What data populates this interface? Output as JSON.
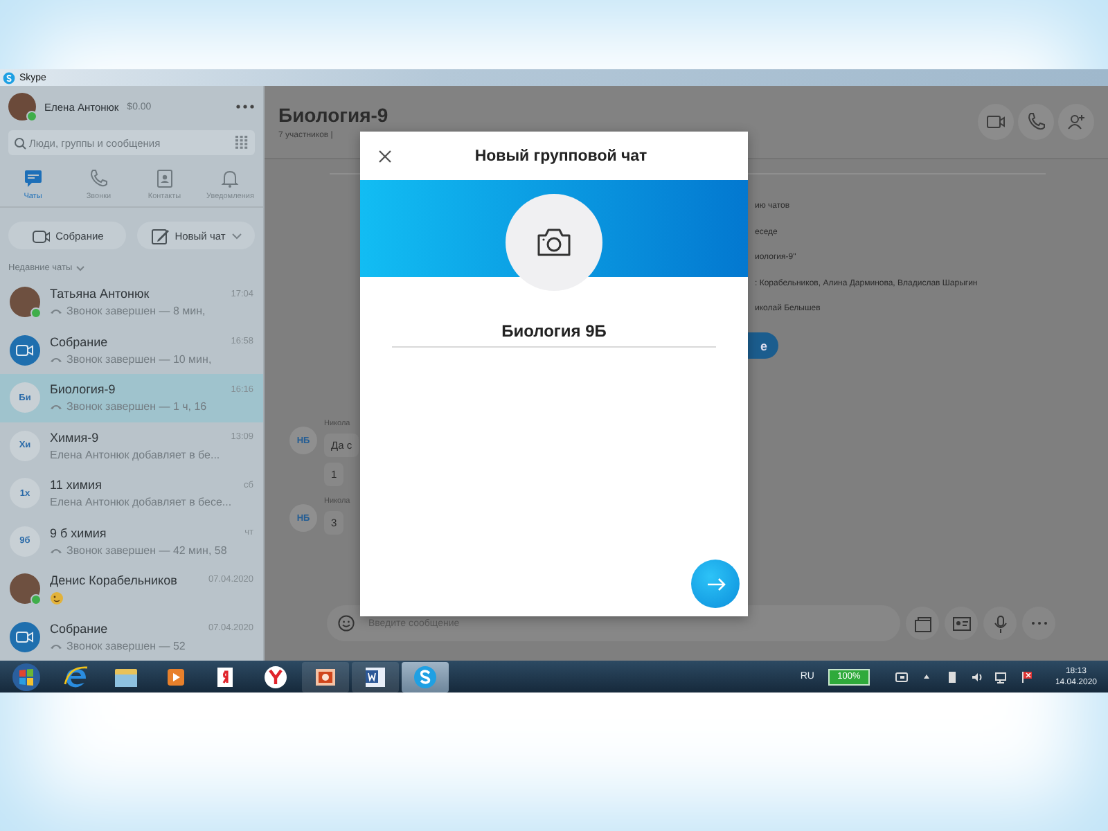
{
  "window": {
    "title": "Skype"
  },
  "sidebar": {
    "profile": {
      "name": "Елена Антонюк",
      "balance": "$0.00",
      "online": true
    },
    "search": {
      "placeholder": "Люди, группы и сообщения"
    },
    "nav": [
      {
        "label": "Чаты",
        "kind": "chat",
        "selected": true
      },
      {
        "label": "Звонки",
        "kind": "phone",
        "selected": false
      },
      {
        "label": "Контакты",
        "kind": "contacts",
        "selected": false
      },
      {
        "label": "Уведомления",
        "kind": "bell",
        "selected": false
      }
    ],
    "actions": [
      {
        "label": "Собрание",
        "kind": "meeting",
        "dropdown": false
      },
      {
        "label": "Новый чат",
        "kind": "compose",
        "dropdown": true
      }
    ],
    "recent_header": "Недавние чаты",
    "chats": [
      {
        "kind": "photo",
        "name": "Татьяна Антонюк",
        "time": "17:04",
        "ended_call": true,
        "preview": "Звонок завершен — 8 мин,",
        "emoji": false,
        "online": true,
        "selected": false
      },
      {
        "kind": "meeting",
        "name": "Собрание",
        "time": "16:58",
        "ended_call": true,
        "preview": "Звонок завершен — 10 мин,",
        "emoji": false,
        "online": false,
        "selected": false
      },
      {
        "kind": "initials",
        "initials": "Би",
        "name": "Биология-9",
        "time": "16:16",
        "ended_call": true,
        "preview": "Звонок завершен — 1 ч, 16",
        "emoji": false,
        "online": false,
        "selected": true
      },
      {
        "kind": "initials",
        "initials": "Хи",
        "name": "Химия-9",
        "time": "13:09",
        "ended_call": false,
        "preview": "Елена Антонюк добавляет в бе...",
        "emoji": false,
        "online": false,
        "selected": false
      },
      {
        "kind": "initials",
        "initials": "1х",
        "name": "11 химия",
        "time": "сб",
        "ended_call": false,
        "preview": "Елена Антонюк добавляет в бесе...",
        "emoji": false,
        "online": false,
        "selected": false
      },
      {
        "kind": "initials",
        "initials": "9б",
        "name": "9 б химия",
        "time": "чт",
        "ended_call": true,
        "preview": "Звонок завершен — 42 мин, 58",
        "emoji": false,
        "online": false,
        "selected": false
      },
      {
        "kind": "photo",
        "name": "Денис Корабельников",
        "time": "07.04.2020",
        "ended_call": false,
        "emoji": true,
        "online": true,
        "selected": false
      },
      {
        "kind": "meeting",
        "name": "Собрание",
        "time": "07.04.2020",
        "ended_call": true,
        "preview": "Звонок завершен — 52",
        "emoji": false,
        "online": false,
        "selected": false
      }
    ]
  },
  "main": {
    "title": "Биология-9",
    "subtitle": "7 участников |",
    "events": [
      "ию чатов",
      "еседе",
      "иология-9\"",
      ": Корабельников, Алина Дарминова, Владислав Шарыгин",
      "иколай Белышев"
    ],
    "event_button": "е",
    "messages": [
      {
        "initials": "НБ",
        "author": "Никола",
        "bubbles": [
          "Да с",
          "1"
        ]
      },
      {
        "initials": "НБ",
        "author": "Никола",
        "bubbles": [
          "3"
        ]
      }
    ],
    "composer": {
      "placeholder": "Введите сообщение"
    }
  },
  "dialog": {
    "title": "Новый групповой чат",
    "group_name": "Биология 9Б"
  },
  "taskbar": {
    "apps": [
      {
        "kind": "start",
        "selected": false
      },
      {
        "kind": "ie",
        "selected": false
      },
      {
        "kind": "folder",
        "selected": false
      },
      {
        "kind": "media",
        "selected": false
      },
      {
        "kind": "yandex",
        "selected": false
      },
      {
        "kind": "yabrowser",
        "selected": false
      },
      {
        "kind": "powerpoint",
        "selected": false
      },
      {
        "kind": "word",
        "selected": false
      },
      {
        "kind": "skype",
        "selected": true
      }
    ],
    "language": "RU",
    "battery": "100%",
    "time": "18:13",
    "date": "14.04.2020"
  }
}
